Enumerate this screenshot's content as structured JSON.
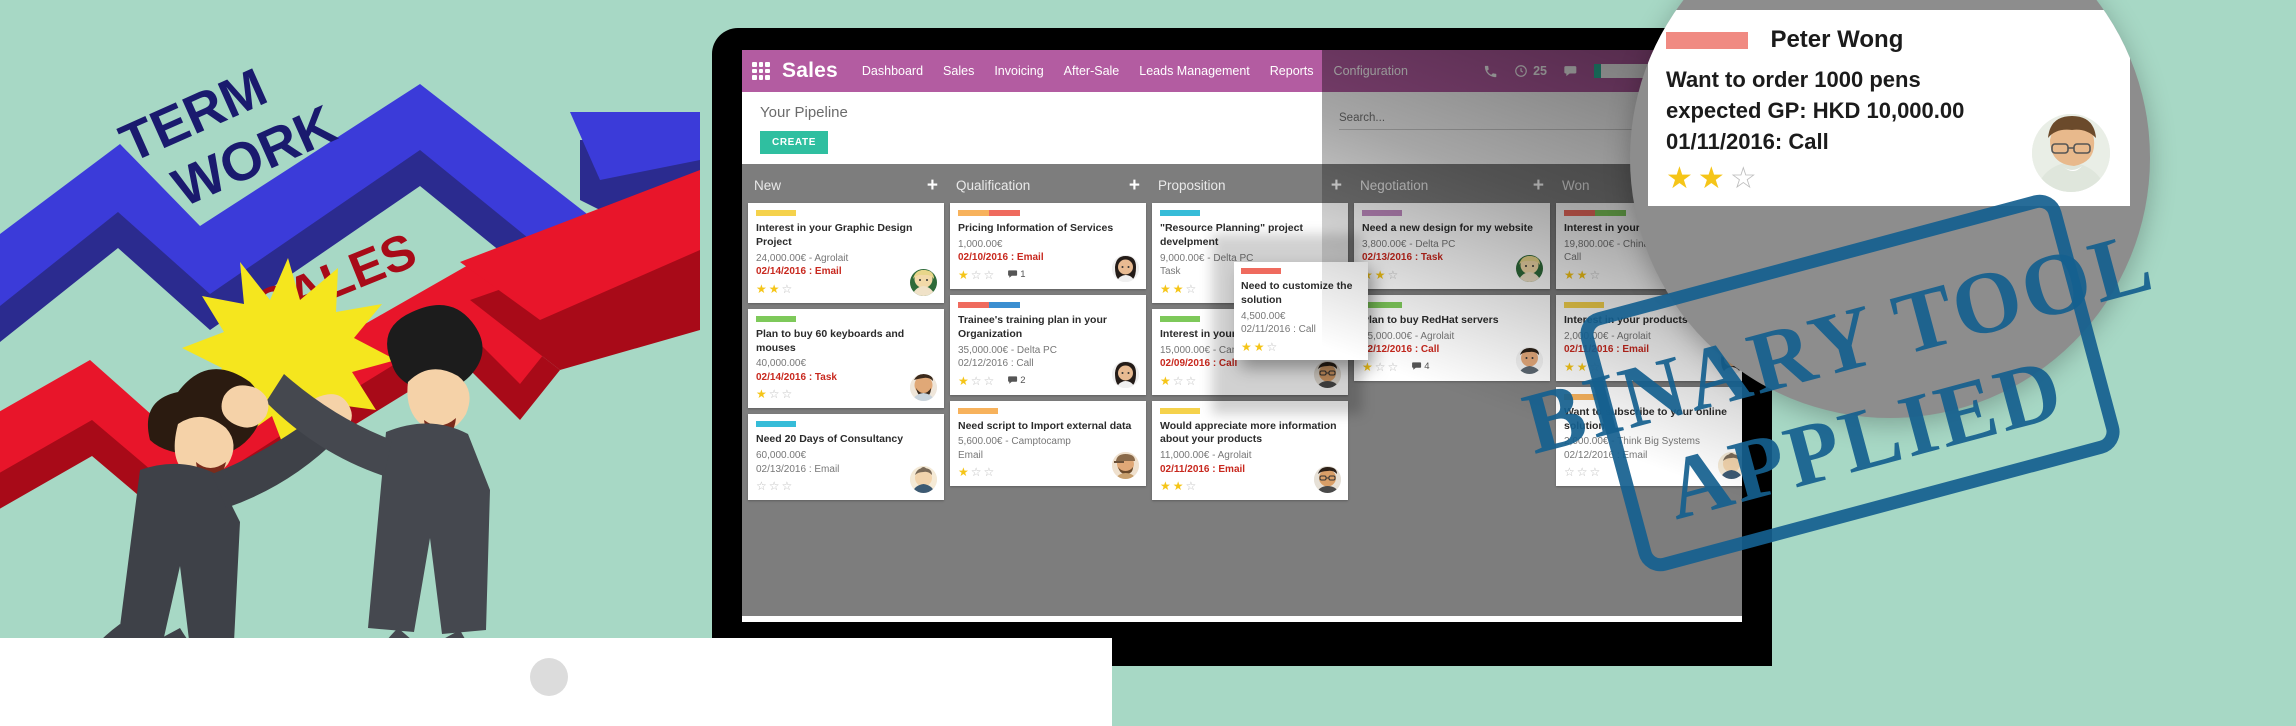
{
  "background": {
    "color": "#a7d8c5",
    "arrows": [
      {
        "label": "TERM\nWORK",
        "line1": "TERM",
        "line2": "WORK",
        "color": "#2f2f9e",
        "accent": "#3b3bd9"
      },
      {
        "label": "SALES",
        "line1": "SALES",
        "color": "#c60c1e",
        "accent": "#e8152a"
      }
    ]
  },
  "navbar": {
    "apps_icon": "apps-grid-icon",
    "brand": "Sales",
    "menu": [
      "Dashboard",
      "Sales",
      "Invoicing",
      "After-Sale",
      "Leads Management",
      "Reports",
      "Configuration"
    ],
    "phone_icon": "phone-icon",
    "activity_icon": "clock-icon",
    "activity_count": "25",
    "messages_icon": "chat-icon",
    "user_placeholder": "",
    "logout_icon": "logout-icon",
    "bg_color": "#b35ca1"
  },
  "control_panel": {
    "title": "Your Pipeline",
    "create_label": "CREATE",
    "create_color": "#2fbfa0",
    "search_placeholder": "Search...",
    "search_value": ""
  },
  "kanban": {
    "bg_color": "#7d7d7d",
    "add_icon": "plus-icon",
    "columns": [
      {
        "name": "New",
        "cards": [
          {
            "tags": [
              "#f5d24c"
            ],
            "title": "Interest in your Graphic Design Project",
            "amount": "24,000.00€ - Agrolait",
            "date": "02/14/2016 : Email",
            "date_urgent": true,
            "stars": 2,
            "messages": "",
            "avatar": "avatar-blonde-woman"
          },
          {
            "tags": [
              "#7ec95a"
            ],
            "title": "Plan to buy 60 keyboards and mouses",
            "amount": "40,000.00€",
            "date": "02/14/2016 : Task",
            "date_urgent": true,
            "stars": 1,
            "messages": "",
            "avatar": "avatar-bearded-man"
          },
          {
            "tags": [
              "#36bcd8"
            ],
            "title": "Need 20 Days of Consultancy",
            "amount": "60,000.00€",
            "date": "02/13/2016 : Email",
            "date_urgent": false,
            "stars": 0,
            "messages": "",
            "avatar": "avatar-bun-woman"
          }
        ]
      },
      {
        "name": "Qualification",
        "cards": [
          {
            "tags": [
              "#f7b25c",
              "#ef6b5e"
            ],
            "title": "Pricing Information of Services",
            "amount": "1,000.00€",
            "date": "02/10/2016 : Email",
            "date_urgent": true,
            "stars": 1,
            "messages": "1",
            "avatar": "avatar-dark-hair-woman"
          },
          {
            "tags": [
              "#ef6b5e",
              "#3b8fd1"
            ],
            "title": "Trainee's training plan in your Organization",
            "amount": "35,000.00€ - Delta PC",
            "date": "02/12/2016 : Call",
            "date_urgent": false,
            "stars": 1,
            "messages": "2",
            "avatar": "avatar-dark-hair-woman"
          },
          {
            "tags": [
              "#f7b25c"
            ],
            "title": "Need script to Import external data",
            "amount": "5,600.00€ - Camptocamp",
            "date": "Email",
            "date_urgent": false,
            "stars": 1,
            "messages": "",
            "avatar": "avatar-cap-man"
          }
        ]
      },
      {
        "name": "Proposition",
        "cards": [
          {
            "tags": [
              "#36bcd8"
            ],
            "title": "\"Resource Planning\" project develpment",
            "amount": "9,000.00€ - Delta PC",
            "date": "Task",
            "date_urgent": false,
            "stars": 2,
            "messages": "",
            "avatar": "avatar-bun-woman"
          },
          {
            "tags": [
              "#7ec95a"
            ],
            "title": "Interest in your customizable Pcs",
            "amount": "15,000.00€ - Camptocamp",
            "date": "02/09/2016 : Call",
            "date_urgent": true,
            "stars": 1,
            "messages": "",
            "avatar": "avatar-glasses-man"
          },
          {
            "tags": [
              "#f5d24c"
            ],
            "title": "Would appreciate more information about your products",
            "amount": "11,000.00€ - Agrolait",
            "date": "02/11/2016 : Email",
            "date_urgent": true,
            "stars": 2,
            "messages": "",
            "avatar": "avatar-glasses-man"
          }
        ]
      },
      {
        "name": "Negotiation",
        "cards": [
          {
            "tags": [
              "#c08ac0"
            ],
            "title": "Need a new design for my website",
            "amount": "3,800.00€ - Delta PC",
            "date": "02/13/2016 : Task",
            "date_urgent": true,
            "stars": 2,
            "messages": "",
            "avatar": "avatar-blonde-woman"
          },
          {
            "tags": [
              "#7ec95a"
            ],
            "title": "Plan to buy RedHat servers",
            "amount": "25,000.00€ - Agrolait",
            "date": "02/12/2016 : Call",
            "date_urgent": true,
            "stars": 1,
            "messages": "4",
            "avatar": "avatar-young-man"
          }
        ]
      },
      {
        "name": "Won",
        "cards": [
          {
            "tags": [
              "#ef6b5e",
              "#7ec95a"
            ],
            "title": "Interest in your Partner Contract",
            "amount": "19,800.00€ - China Export",
            "date": "Call",
            "date_urgent": false,
            "stars": 2,
            "messages": "",
            "avatar": "avatar-bearded-man"
          },
          {
            "tags": [
              "#f5d24c"
            ],
            "title": "Interest in your products",
            "amount": "2,000.00€ - Agrolait",
            "date": "02/11/2016 : Email",
            "date_urgent": true,
            "stars": 2,
            "messages": "",
            "avatar": "avatar-dark-hair-woman"
          },
          {
            "tags": [
              "#f7b25c"
            ],
            "title": "Want to subscribe to your online solution",
            "amount": "2,000.00€ - Think Big Systems",
            "date": "02/12/2016 : Email",
            "date_urgent": false,
            "stars": 0,
            "messages": "",
            "avatar": "avatar-bun-woman"
          }
        ]
      }
    ],
    "drag_card": {
      "tags": [
        "#ef6b5e"
      ],
      "title": "Need to customize the solution",
      "amount": "4,500.00€",
      "date": "02/11/2016 : Call",
      "date_urgent": false,
      "stars": 2
    }
  },
  "magnifier": {
    "top_card": {
      "stars": 2,
      "avatar": "avatar-partial-person"
    },
    "main_card": {
      "tag_color": "#f08a82",
      "name": "Peter Wong",
      "line1": "Want to order 1000 pens",
      "line2": "expected GP: HKD 10,000.00",
      "line3": "01/11/2016: Call",
      "stars": 2,
      "avatar": "avatar-glasses-smiling-man"
    }
  },
  "stamp": {
    "line1": "BINARY TOOL",
    "line2": "APPLIED",
    "color": "#15608f"
  }
}
